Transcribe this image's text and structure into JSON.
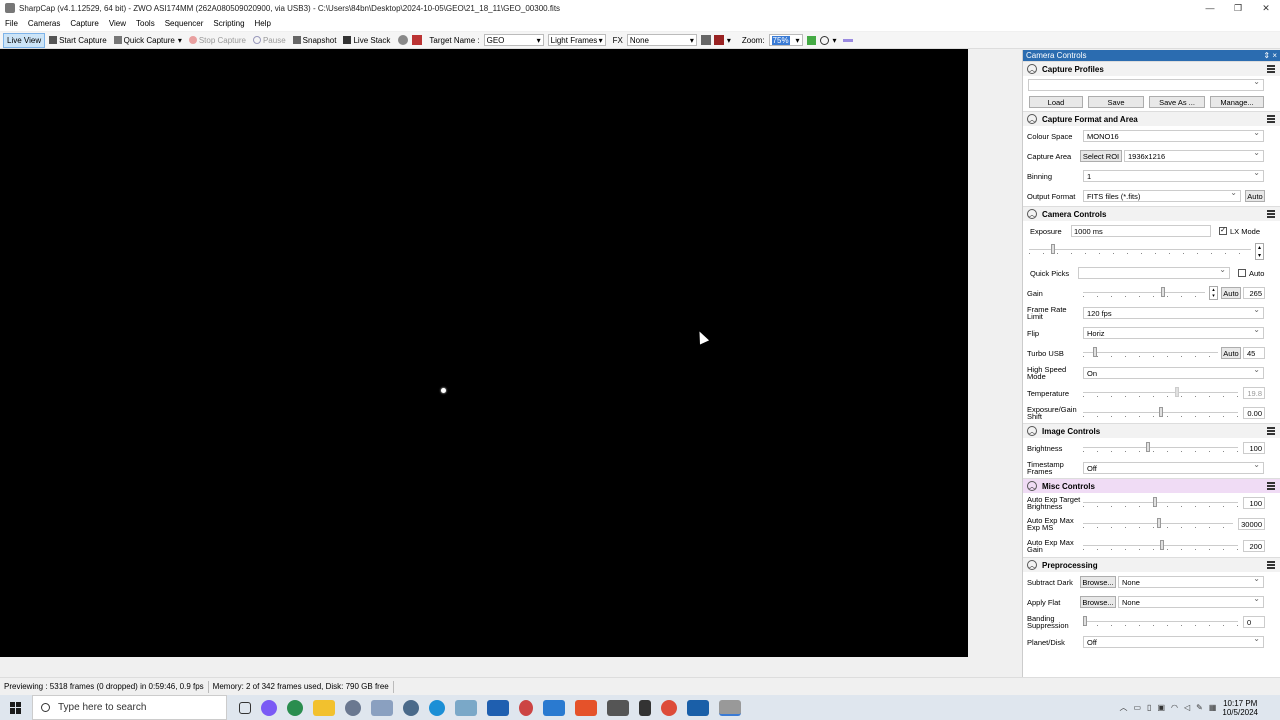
{
  "window": {
    "title": "SharpCap (v4.1.12529, 64 bit) - ZWO ASI174MM (262A080509020900, via USB3) - C:\\Users\\84bn\\Desktop\\2024-10-05\\GEO\\21_18_11\\GEO_00300.fits",
    "minimize": "—",
    "maximize": "❐",
    "close": "✕"
  },
  "menu": [
    "File",
    "Cameras",
    "Capture",
    "View",
    "Tools",
    "Sequencer",
    "Scripting",
    "Help"
  ],
  "toolbar": {
    "live_view": "Live View",
    "start_capture": "Start Capture",
    "quick_capture": "Quick Capture",
    "stop_capture": "Stop Capture",
    "pause": "Pause",
    "snapshot": "Snapshot",
    "live_stack": "Live Stack",
    "target_name_label": "Target Name :",
    "target_name_value": "GEO",
    "frame_type": "Light Frames",
    "fx_label": "FX",
    "fx_value": "None",
    "zoom_label": "Zoom:",
    "zoom_value": "75%"
  },
  "panel": {
    "title": "Camera Controls",
    "pin": "⇕ ×",
    "capture_profiles": {
      "header": "Capture Profiles",
      "profile_value": "",
      "load": "Load",
      "save": "Save",
      "save_as": "Save As ...",
      "manage": "Manage..."
    },
    "format_area": {
      "header": "Capture Format and Area",
      "colour_space_label": "Colour Space",
      "colour_space_value": "MONO16",
      "capture_area_label": "Capture Area",
      "select_roi": "Select ROI",
      "capture_area_value": "1936x1216",
      "binning_label": "Binning",
      "binning_value": "1",
      "output_format_label": "Output Format",
      "output_format_value": "FITS files (*.fits)",
      "auto": "Auto"
    },
    "camera_controls": {
      "header": "Camera Controls",
      "exposure_label": "Exposure",
      "exposure_value": "1000 ms",
      "lx_mode": "LX Mode",
      "quick_picks_label": "Quick Picks",
      "quick_picks_auto": "Auto",
      "gain_label": "Gain",
      "gain_auto": "Auto",
      "gain_value": "265",
      "frame_rate_label": "Frame Rate Limit",
      "frame_rate_value": "120 fps",
      "flip_label": "Flip",
      "flip_value": "Horiz",
      "turbo_usb_label": "Turbo USB",
      "turbo_usb_auto": "Auto",
      "turbo_usb_value": "45",
      "high_speed_label": "High Speed Mode",
      "high_speed_value": "On",
      "temperature_label": "Temperature",
      "temperature_value": "19.8",
      "exposure_gain_shift_label": "Exposure/Gain Shift",
      "exposure_gain_shift_value": "0.00"
    },
    "image_controls": {
      "header": "Image Controls",
      "brightness_label": "Brightness",
      "brightness_value": "100",
      "timestamp_label": "Timestamp Frames",
      "timestamp_value": "Off"
    },
    "misc_controls": {
      "header": "Misc Controls",
      "auto_exp_target_label": "Auto Exp Target Brightness",
      "auto_exp_target_value": "100",
      "auto_exp_max_ms_label": "Auto Exp Max Exp MS",
      "auto_exp_max_ms_value": "30000",
      "auto_exp_max_gain_label": "Auto Exp Max Gain",
      "auto_exp_max_gain_value": "200"
    },
    "preprocessing": {
      "header": "Preprocessing",
      "subtract_dark_label": "Subtract Dark",
      "subtract_dark_browse": "Browse...",
      "subtract_dark_value": "None",
      "apply_flat_label": "Apply Flat",
      "apply_flat_browse": "Browse...",
      "apply_flat_value": "None",
      "banding_label": "Banding Suppression",
      "banding_value": "0",
      "planet_disk_label": "Planet/Disk",
      "planet_disk_value": "Off"
    }
  },
  "status": {
    "previewing": "Previewing : 5318 frames (0 dropped) in 0:59:46, 0.9 fps",
    "memory": "Memory: 2 of 342 frames used, Disk: 790 GB free"
  },
  "taskbar": {
    "search_placeholder": "Type here to search",
    "time": "10:17 PM",
    "date": "10/5/2024"
  }
}
